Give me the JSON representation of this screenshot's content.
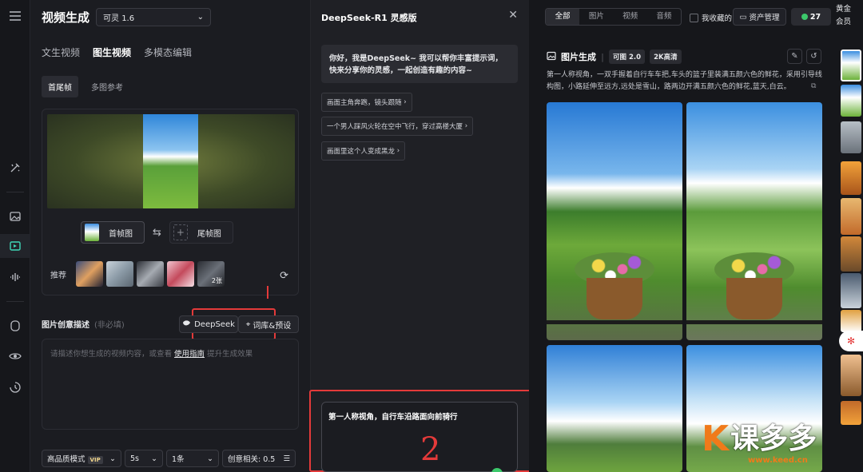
{
  "left": {
    "title": "视频生成",
    "model": "可灵 1.6",
    "tabs": [
      "文生视频",
      "图生视频",
      "多模态编辑"
    ],
    "subtabs": [
      "首尾帧",
      "多图参考"
    ],
    "first_frame_label": "首帧图",
    "last_frame_label": "尾帧图",
    "recommend_label": "推荐",
    "recommend_count": "2张",
    "desc_title": "图片创意描述",
    "desc_optional": "(非必填)",
    "deepseek_label": "DeepSeek",
    "library_label": "词库&预设",
    "prompt_placeholder_a": "请描述你想生成的视频内容，或查看 ",
    "prompt_placeholder_link": "使用指南",
    "prompt_placeholder_b": " 提升生成效果",
    "quality_mode": "高品质模式",
    "vip_badge": "VIP",
    "duration": "5s",
    "count": "1条",
    "creativity": "创意相关: 0.5"
  },
  "mid": {
    "title": "DeepSeek-R1 灵感版",
    "greeting": "你好，我是DeepSeek~ 我可以帮你丰富提示词，快来分享你的灵感，一起创造有趣的内容~",
    "suggestions": [
      "画面主角奔跑，镜头跟随",
      "一个男人踩风火轮在空中飞行，穿过高楼大厦",
      "画面里这个人变成黑龙"
    ],
    "input_value": "第一人称视角，自行车沿路面向前骑行",
    "annotation_number": "2"
  },
  "right": {
    "filters": [
      "全部",
      "图片",
      "视频",
      "音频"
    ],
    "favorites_label": "我收藏的",
    "asset_label": "资产管理",
    "credits": "27",
    "member": "黄金会员",
    "gen_title": "图片生成",
    "tags": [
      "可图 2.0",
      "2K高清"
    ],
    "gen_desc": "第一人称视角，一双手握着自行车车把,车头的篮子里装满五颜六色的鲜花，采用引导线构图，小路延伸至远方,远处是雪山，路两边开满五颜六色的鲜花,蓝天,白云。"
  },
  "watermark": {
    "brand": "课多多",
    "url": "www.keed.cn"
  },
  "colors": {
    "accent": "#3fd8b8",
    "annotation": "#e43a3a",
    "brand": "#f07a1a"
  }
}
